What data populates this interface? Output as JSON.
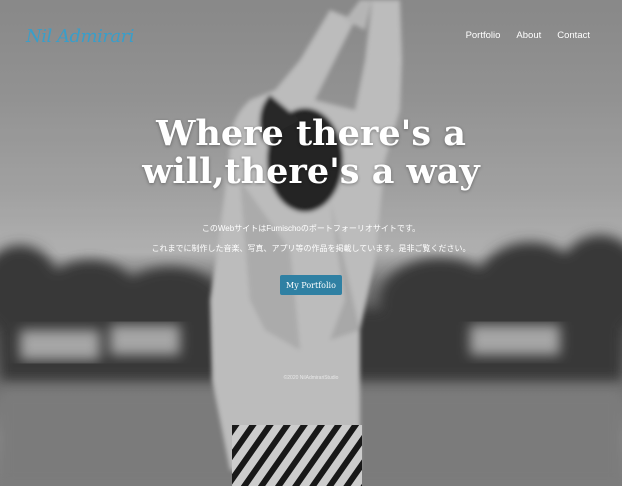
{
  "header": {
    "logo_text": "Nil Admirari",
    "nav": [
      "Portfolio",
      "About",
      "Contact"
    ]
  },
  "hero": {
    "headline_line1": "Where there's a",
    "headline_line2": "will,there's a way",
    "subtitle_line1": "このWebサイトはFumischoのポートフォーリオサイトです。",
    "subtitle_line2": "これまでに制作した音楽、写真、アプリ等の作品を掲載しています。是非ご覧ください。",
    "cta_label": "My Portfolio",
    "copyright": "©2020 NilAdmirariStudio"
  },
  "colors": {
    "accent": "#2f80a3",
    "logo": "#3a9ec9"
  }
}
